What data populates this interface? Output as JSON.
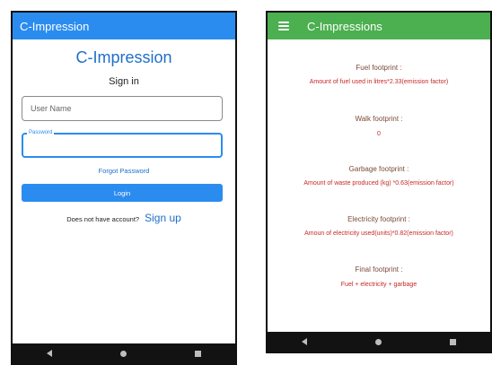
{
  "login_screen": {
    "appbar_title": "C-Impression",
    "heading": "C-Impression",
    "subheading": "Sign in",
    "username_placeholder": "User Name",
    "password_label": "Password",
    "forgot_password": "Forgot Password",
    "login_button": "Login",
    "signup_prompt": "Does not have account?",
    "signup_link": "Sign up"
  },
  "footprint_screen": {
    "appbar_title": "C-Impressions",
    "sections": [
      {
        "title": "Fuel footprint :",
        "value": "Amount of fuel used in litres*2.33(emission factor)"
      },
      {
        "title": "Walk footprint :",
        "value": "0"
      },
      {
        "title": "Garbage footprint :",
        "value": "Amount of waste produced (kg) *0.63(emission factor)"
      },
      {
        "title": "Electricity footprint :",
        "value": "Amoun of electricity used(units)*0.82(emission factor)"
      },
      {
        "title": "Final footprint :",
        "value": "Fuel + electricity + garbage"
      }
    ]
  },
  "colors": {
    "primary_blue": "#2b8cf0",
    "appbar_green": "#4caf50",
    "title_brown": "#7b4a3b",
    "value_red": "#c62828"
  },
  "icons": {
    "menu": "hamburger-icon",
    "nav_back": "back-triangle-icon",
    "nav_home": "home-circle-icon",
    "nav_recents": "recents-square-icon"
  }
}
